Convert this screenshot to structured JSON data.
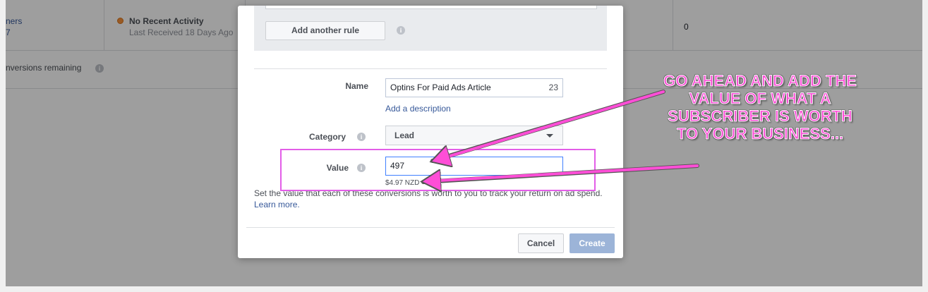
{
  "background": {
    "row1_link_top": "ners",
    "row1_link_bottom": "7",
    "activity_title": "No Recent Activity",
    "activity_sub": "Last Received 18 Days Ago",
    "count_value": "0",
    "conversions_remaining": "nversions remaining"
  },
  "modal": {
    "add_rule_label": "Add another rule",
    "name_label": "Name",
    "name_value": "Optins For Paid Ads Article",
    "name_counter": "23",
    "add_description": "Add a description",
    "category_label": "Category",
    "category_value": "Lead",
    "value_label": "Value",
    "value_input": "497",
    "value_converted": "$4.97 NZD",
    "help_text": "Set the value that each of these conversions is worth to you to track your return on ad spend.",
    "learn_more": "Learn more.",
    "cancel_label": "Cancel",
    "create_label": "Create"
  },
  "annotation": {
    "text": "GO AHEAD AND ADD THE VALUE OF WHAT A SUBSCRIBER IS WORTH TO YOUR BUSINESS...",
    "color": "#ff4ed7"
  },
  "icons": [
    "info-icon",
    "status-dot-icon",
    "dropdown-caret-icon",
    "arrow-annotation"
  ]
}
